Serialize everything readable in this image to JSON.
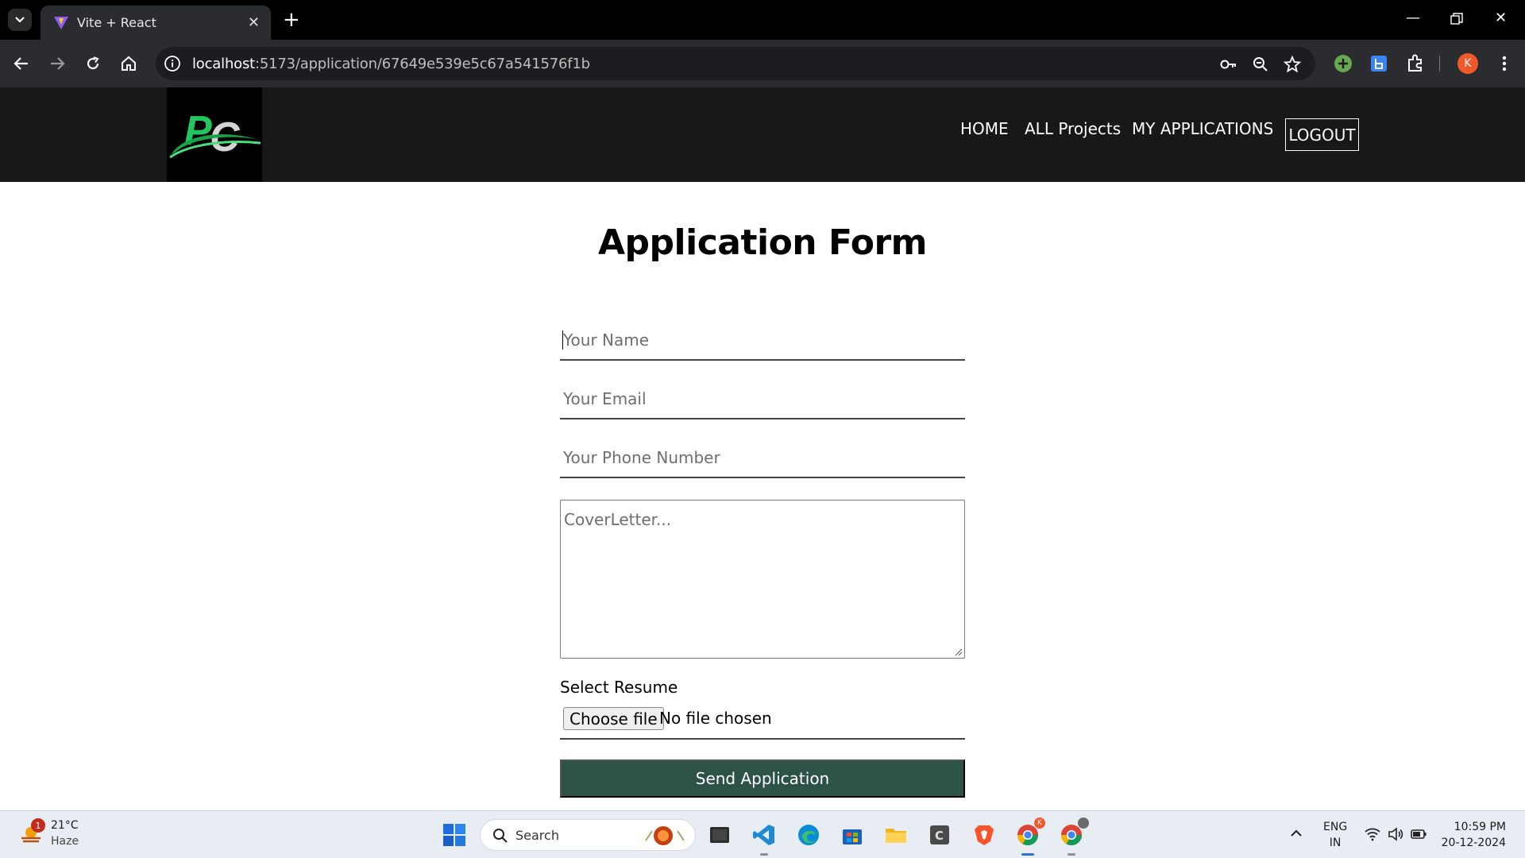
{
  "browser": {
    "tab_title": "Vite + React",
    "url_host": "localhost",
    "url_rest": ":5173/application/67649e539e5c67a541576f1b",
    "profile_initial": "K"
  },
  "site": {
    "logo_text": "PC",
    "nav": [
      "HOME",
      "ALL Projects",
      "MY APPLICATIONS"
    ],
    "logout_label": "LOGOUT"
  },
  "form": {
    "title": "Application Form",
    "name_placeholder": "Your Name",
    "email_placeholder": "Your Email",
    "phone_placeholder": "Your Phone Number",
    "cover_placeholder": "CoverLetter...",
    "resume_label": "Select Resume",
    "choose_file_label": "Choose file",
    "file_status": "No file chosen",
    "submit_label": "Send Application"
  },
  "taskbar": {
    "weather_temp": "21°C",
    "weather_desc": "Haze",
    "weather_badge": "1",
    "search_label": "Search",
    "lang_line1": "ENG",
    "lang_line2": "IN",
    "time": "10:59 PM",
    "date": "20-12-2024"
  },
  "colors": {
    "header_bg": "#17181a",
    "submit_bg": "#2d5247",
    "logo_green": "#27c93f"
  }
}
